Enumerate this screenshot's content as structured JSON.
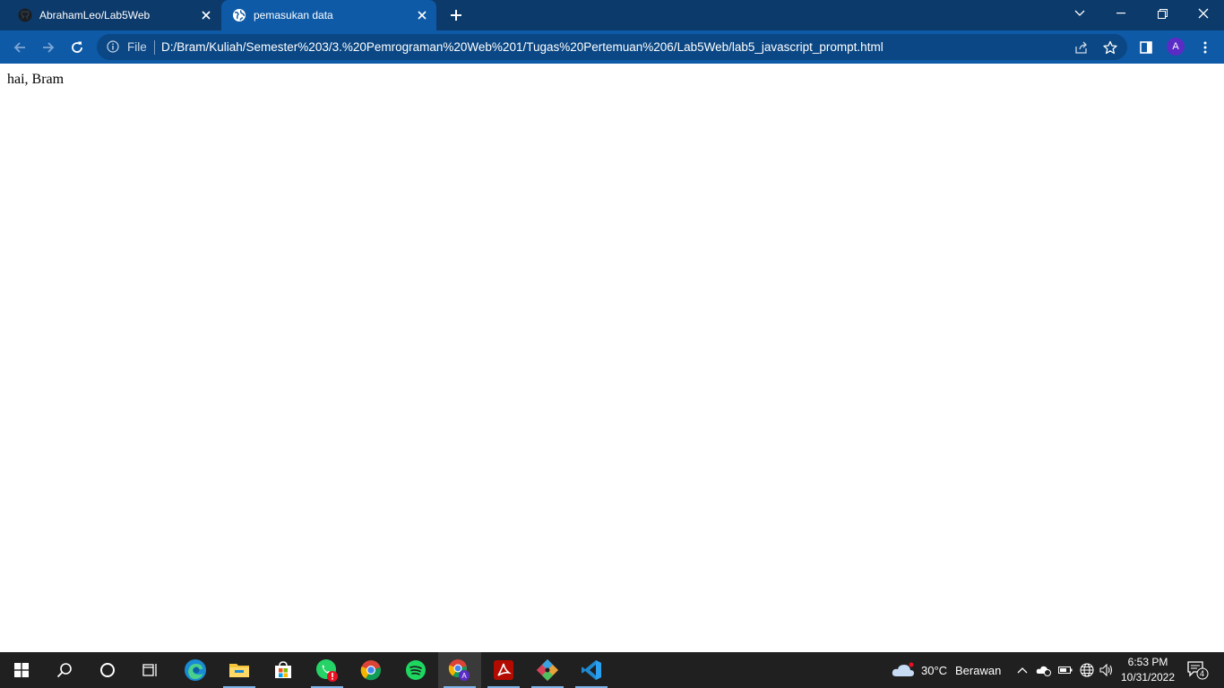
{
  "browser": {
    "tabs": [
      {
        "title": "AbrahamLeo/Lab5Web",
        "icon": "github-icon",
        "active": false
      },
      {
        "title": "pemasukan data",
        "icon": "globe-icon",
        "active": true
      }
    ],
    "address_bar": {
      "scheme_label": "File",
      "url": "D:/Bram/Kuliah/Semester%203/3.%20Pemrograman%20Web%201/Tugas%20Pertemuan%206/Lab5Web/lab5_javascript_prompt.html"
    },
    "profile_initial": "A",
    "accent_color": "#0e5aa7",
    "tabstrip_color": "#0c3a6b"
  },
  "page": {
    "text": "hai, Bram"
  },
  "taskbar": {
    "apps": [
      "windows-start",
      "search",
      "cortana",
      "task-view",
      "edge",
      "file-explorer",
      "microsoft-store",
      "whatsapp",
      "chrome",
      "spotify",
      "chrome-profile",
      "acrobat",
      "git",
      "vscode"
    ],
    "weather": {
      "temperature": "30°C",
      "condition": "Berawan"
    },
    "clock": {
      "time": "6:53 PM",
      "date": "10/31/2022"
    },
    "notification_count": "4"
  }
}
